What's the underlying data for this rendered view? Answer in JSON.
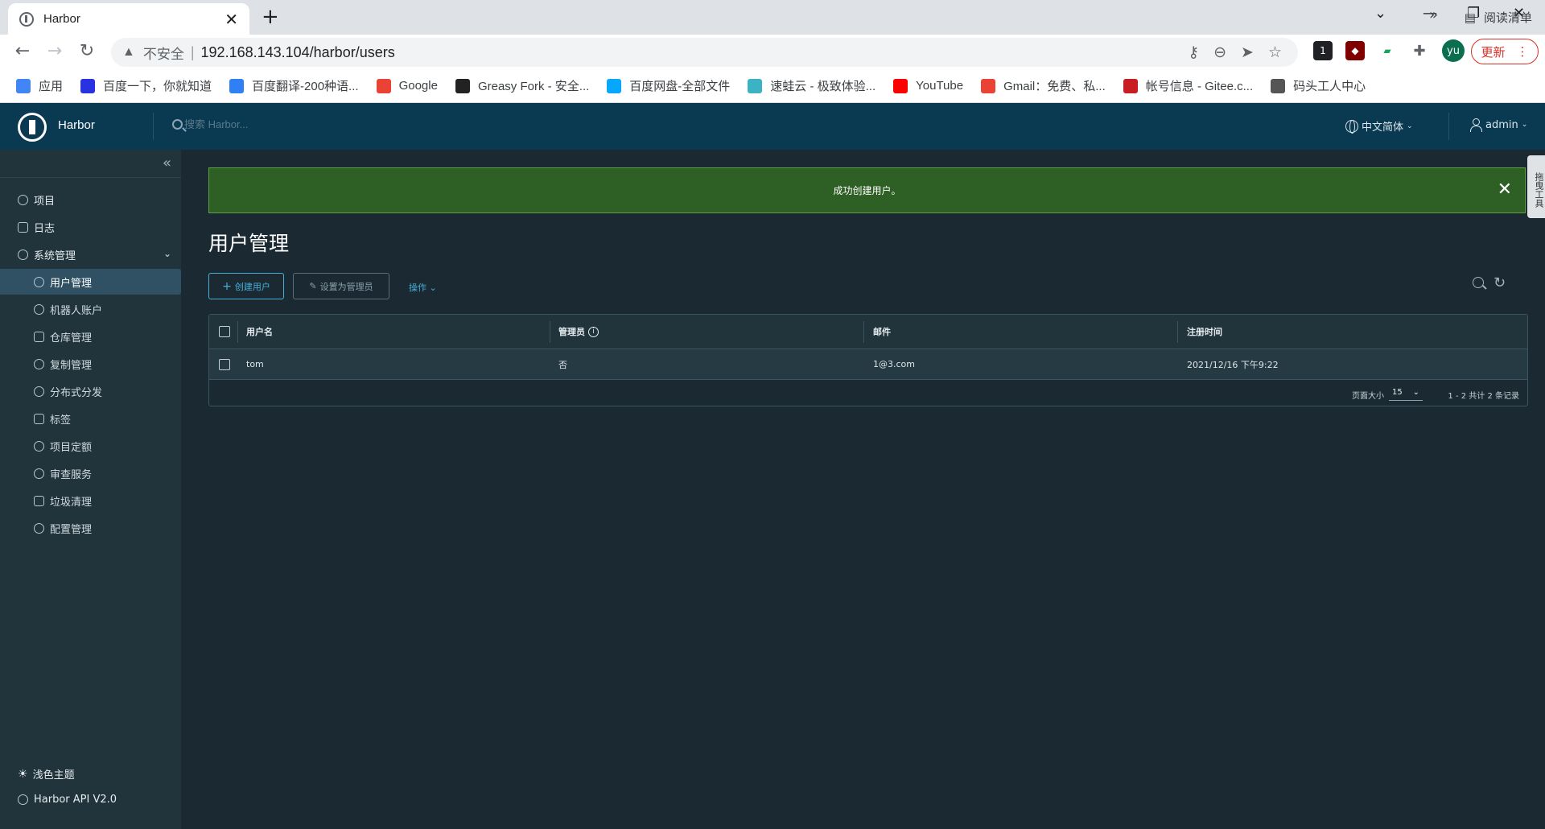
{
  "browser": {
    "tab_title": "Harbor",
    "tab_close": "✕",
    "new_tab": "+",
    "insecure_label": "不安全",
    "url": "192.168.143.104/harbor/users",
    "profile_initials": "yu",
    "update_label": "更新",
    "ext_badge": "1",
    "bookmarks": [
      {
        "label": "应用",
        "color": "#4285f4"
      },
      {
        "label": "百度一下，你就知道",
        "color": "#2932e1"
      },
      {
        "label": "百度翻译-200种语...",
        "color": "#2f7ff5"
      },
      {
        "label": "Google",
        "color": "#ea4335"
      },
      {
        "label": "Greasy Fork - 安全...",
        "color": "#222222"
      },
      {
        "label": "百度网盘-全部文件",
        "color": "#06a7ff"
      },
      {
        "label": "速蛙云 - 极致体验...",
        "color": "#3bb3c3"
      },
      {
        "label": "YouTube",
        "color": "#ff0000"
      },
      {
        "label": "Gmail：免费、私...",
        "color": "#ea4335"
      },
      {
        "label": "帐号信息 - Gitee.c...",
        "color": "#c71d23"
      },
      {
        "label": "码头工人中心",
        "color": "#555555"
      }
    ],
    "bookmarks_more": "»",
    "reading_list": "阅读清单"
  },
  "header": {
    "brand": "Harbor",
    "search_placeholder": "搜索 Harbor...",
    "language": "中文简体",
    "user": "admin"
  },
  "sidebar": {
    "collapse": "«",
    "items": [
      {
        "label": "项目"
      },
      {
        "label": "日志"
      },
      {
        "label": "系统管理"
      }
    ],
    "sub_items": [
      {
        "label": "用户管理"
      },
      {
        "label": "机器人账户"
      },
      {
        "label": "仓库管理"
      },
      {
        "label": "复制管理"
      },
      {
        "label": "分布式分发"
      },
      {
        "label": "标签"
      },
      {
        "label": "项目定额"
      },
      {
        "label": "审查服务"
      },
      {
        "label": "垃圾清理"
      },
      {
        "label": "配置管理"
      }
    ],
    "footer": {
      "theme": "浅色主题",
      "api": "Harbor API V2.0"
    }
  },
  "main": {
    "alert": "成功创建用户。",
    "side_tab": "拖曳工具",
    "title": "用户管理",
    "create_user": "创建用户",
    "set_admin": "设置为管理员",
    "operations": "操作",
    "columns": [
      "用户名",
      "管理员",
      "邮件",
      "注册时间"
    ],
    "rows": [
      {
        "username": "tom",
        "admin": "否",
        "email": "1@3.com",
        "registered": "2021/12/16 下午9:22"
      }
    ],
    "page_size_label": "页面大小",
    "page_size": "15",
    "range": "1 - 2 共计 2 条记录"
  },
  "colors": {
    "header_bg": "#0a3a52",
    "sidebar_bg": "#21333b",
    "main_bg": "#1b2a32",
    "accent": "#49afd9",
    "success": "#2e5f24"
  }
}
